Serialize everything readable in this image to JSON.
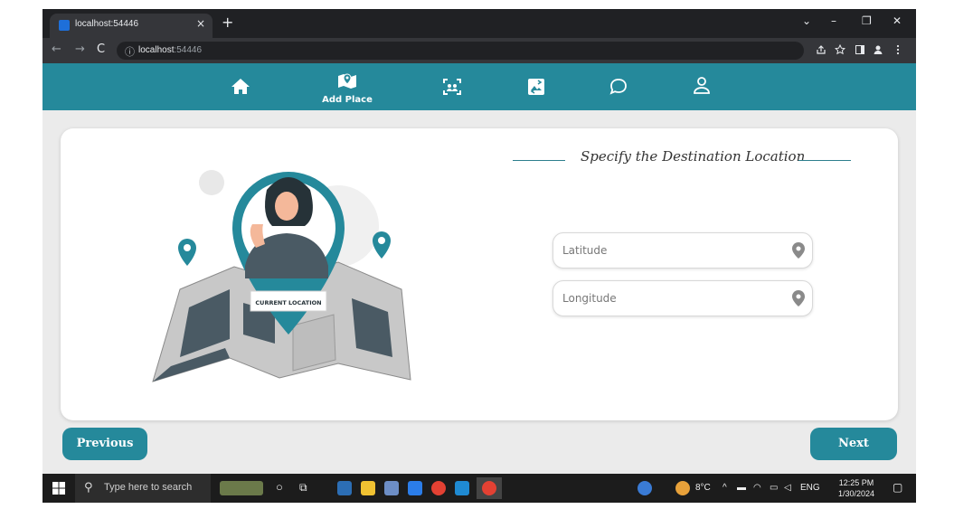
{
  "browser": {
    "tab_title": "localhost:54446",
    "tab_close": "×",
    "new_tab": "+",
    "url_host": "localhost",
    "url_port": ":54446",
    "window_controls": [
      "⌄",
      "–",
      "❐",
      "✕"
    ]
  },
  "nav": {
    "items": [
      {
        "name": "home",
        "icon": "home-icon",
        "label": ""
      },
      {
        "name": "add-place",
        "icon": "map-pin-icon",
        "label": "Add Place"
      },
      {
        "name": "scan",
        "icon": "group-scan-icon",
        "label": ""
      },
      {
        "name": "gallery",
        "icon": "image-swap-icon",
        "label": ""
      },
      {
        "name": "chat",
        "icon": "chat-bubble-icon",
        "label": ""
      },
      {
        "name": "profile",
        "icon": "user-icon",
        "label": ""
      }
    ]
  },
  "illustration": {
    "badge_text": "CURRENT LOCATION"
  },
  "form": {
    "title": "Specify the Destination Location",
    "latitude_placeholder": "Latitude",
    "longitude_placeholder": "Longitude"
  },
  "buttons": {
    "previous": "Previous",
    "next": "Next"
  },
  "taskbar": {
    "search_placeholder": "Type here to search",
    "weather": "8°C",
    "language": "ENG",
    "time": "12:25 PM",
    "date": "1/30/2024"
  },
  "colors": {
    "accent": "#25899b",
    "background": "#ebebeb",
    "card": "#ffffff"
  }
}
